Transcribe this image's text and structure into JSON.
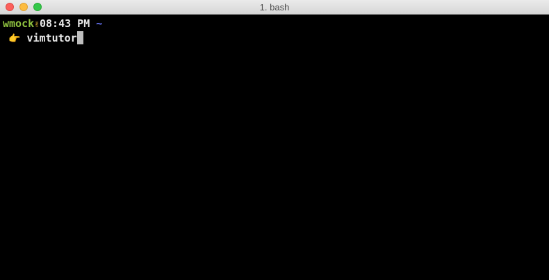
{
  "window": {
    "title": "1. bash"
  },
  "prompt": {
    "user": "wmock",
    "separator_icon": "✌",
    "time": "08:43 PM",
    "directory": "~",
    "input_icon": "👉",
    "command": "vimtutor"
  },
  "colors": {
    "user": "#8fc23f",
    "directory": "#6a78ff",
    "background": "#000000",
    "text": "#e8e8e8"
  }
}
